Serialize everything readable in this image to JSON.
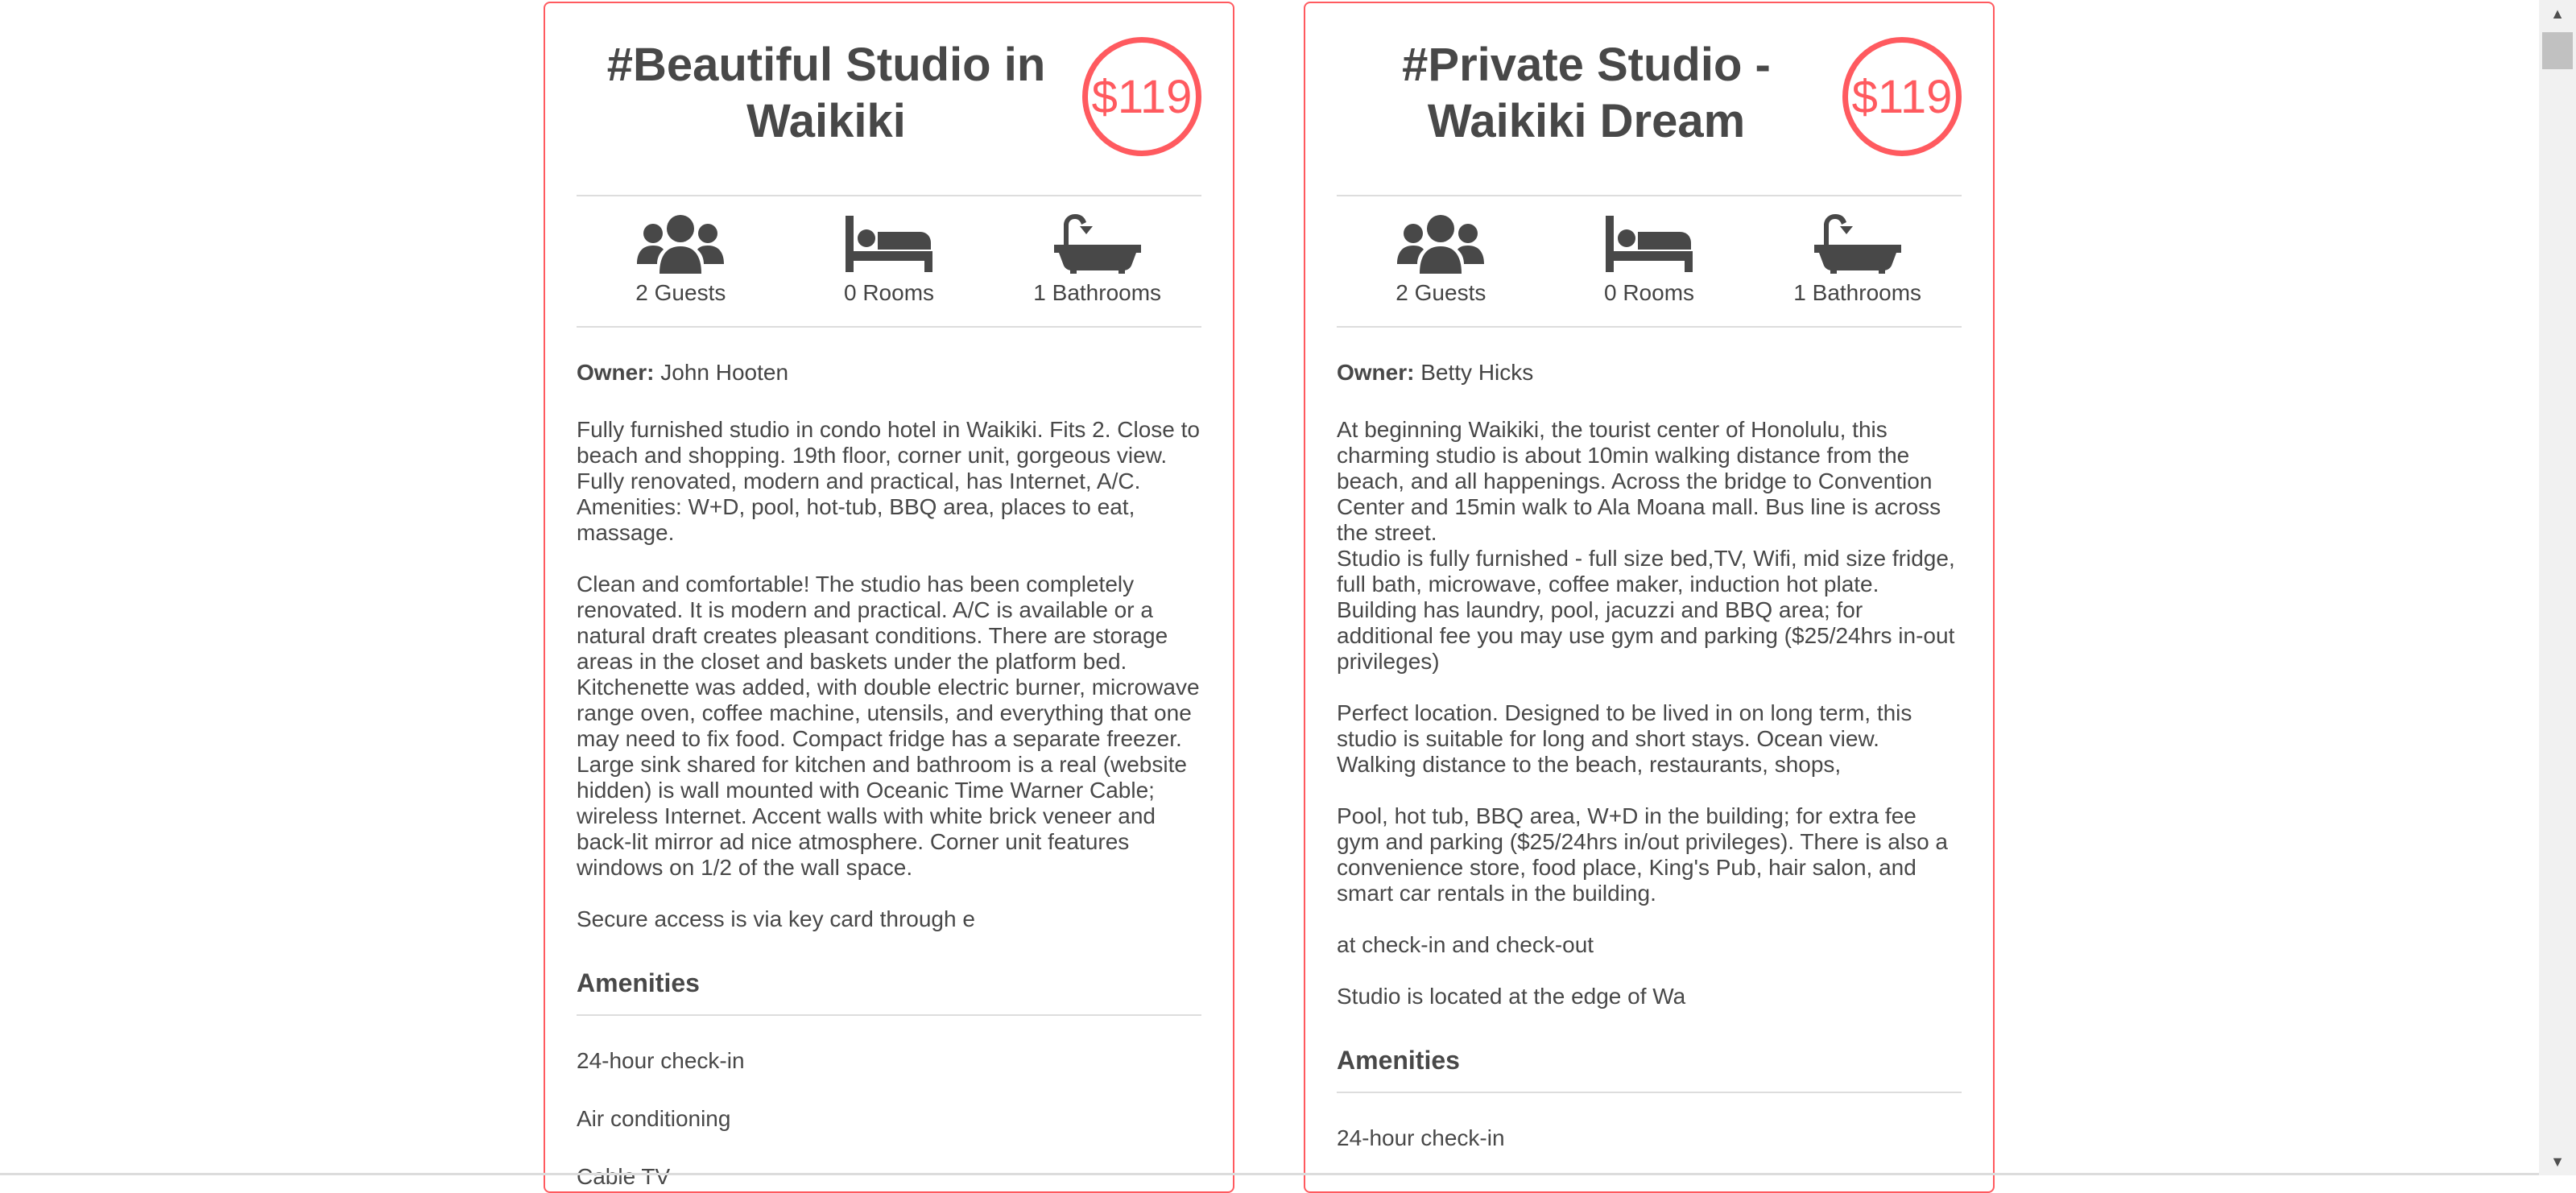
{
  "colors": {
    "accent": "#ff5a5f",
    "text": "#484848",
    "divider": "#dddddd"
  },
  "listings": [
    {
      "title": "#Beautiful Studio in Waikiki",
      "price": "$119",
      "stats": {
        "guests": "2 Guests",
        "rooms": "0 Rooms",
        "bathrooms": "1 Bathrooms"
      },
      "owner_label": "Owner:",
      "owner": "John Hooten",
      "description": [
        "Fully furnished studio in condo hotel in Waikiki. Fits 2. Close to beach and shopping. 19th floor, corner unit, gorgeous view. Fully renovated, modern and practical, has Internet, A/C. Amenities: W+D, pool, hot-tub, BBQ area, places to eat, massage.",
        "Clean and comfortable! The studio has been completely renovated. It is modern and practical. A/C is available or a natural draft creates pleasant conditions. There are storage areas in the closet and baskets under the platform bed. Kitchenette was added, with double electric burner, microwave range oven, coffee machine, utensils, and everything that one may need to fix food. Compact fridge has a separate freezer. Large sink shared for kitchen and bathroom is a real (website hidden) is wall mounted with Oceanic Time Warner Cable; wireless Internet. Accent walls with white brick veneer and back-lit mirror ad nice atmosphere. Corner unit features windows on 1/2 of the wall space.",
        "Secure access is via key card through e"
      ],
      "amenities_title": "Amenities",
      "amenities": [
        "24-hour check-in",
        "Air conditioning",
        "Cable TV"
      ]
    },
    {
      "title": "#Private Studio - Waikiki Dream",
      "price": "$119",
      "stats": {
        "guests": "2 Guests",
        "rooms": "0 Rooms",
        "bathrooms": "1 Bathrooms"
      },
      "owner_label": "Owner:",
      "owner": "Betty Hicks",
      "description": [
        "At beginning Waikiki, the tourist center of Honolulu, this charming studio is about 10min walking distance from the beach, and all happenings. Across the bridge to Convention Center and 15min walk to Ala Moana mall. Bus line is across the street.\nStudio is fully furnished - full size bed,TV, Wifi, mid size fridge, full bath, microwave, coffee maker, induction hot plate. Building has laundry, pool, jacuzzi and BBQ area; for additional fee you may use gym and parking ($25/24hrs in-out privileges)",
        "Perfect location. Designed to be lived in on long term, this studio is suitable for long and short stays. Ocean view. Walking distance to the beach, restaurants, shops,",
        "Pool, hot tub, BBQ area, W+D in the building; for extra fee gym and parking ($25/24hrs in/out privileges). There is also a convenience store, food place, King's Pub, hair salon, and smart car rentals in the building.",
        "at check-in and check-out",
        "Studio is located at the edge of Wa"
      ],
      "amenities_title": "Amenities",
      "amenities": [
        "24-hour check-in"
      ]
    }
  ]
}
